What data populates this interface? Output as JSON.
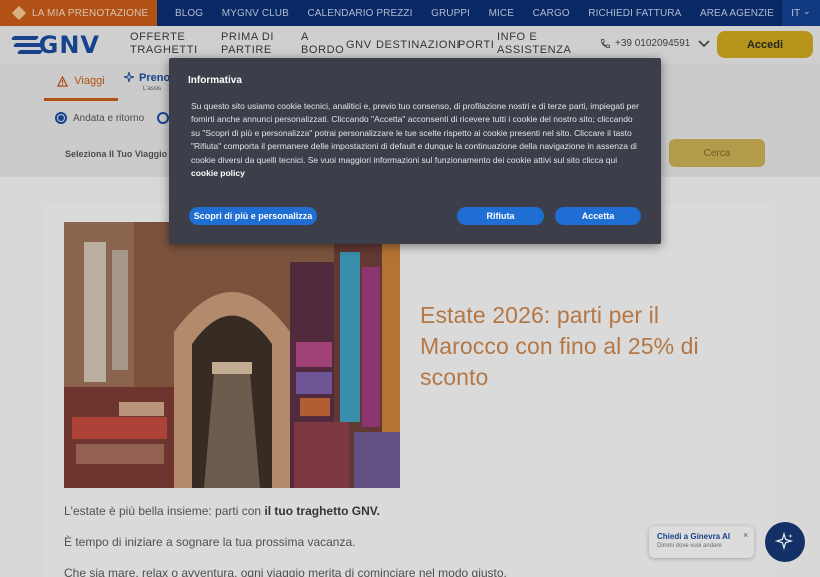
{
  "topbar": {
    "booking": "LA MIA PRENOTAZIONE",
    "links": [
      "BLOG",
      "MYGNV CLUB",
      "CALENDARIO PREZZI",
      "GRUPPI",
      "MICE",
      "CARGO",
      "RICHIEDI FATTURA",
      "AREA AGENZIE"
    ],
    "lang": "IT",
    "lang_chevron": "⌄"
  },
  "nav": {
    "logo": "GNV",
    "items": [
      {
        "line1": "OFFERTE",
        "line2": "TRAGHETTI"
      },
      {
        "line1": "PRIMA DI",
        "line2": "PARTIRE"
      },
      {
        "line1": "A",
        "line2": "BORDO"
      },
      {
        "line1": "GNV",
        "line2": ""
      },
      {
        "line1": "DESTINAZIONI",
        "line2": ""
      },
      {
        "line1": "PORTI",
        "line2": ""
      },
      {
        "line1": "INFO E",
        "line2": "ASSISTENZA"
      }
    ],
    "phone": "+39 0102094591",
    "login": "Accedi"
  },
  "search": {
    "tab_viaggi": "Viaggi",
    "tab_preno": "Preno",
    "tab_preno_sub": "L'assis",
    "radio_round": "Andata e ritorno",
    "route_label": "Seleziona Il Tuo Viaggio",
    "search_button": "Cerca"
  },
  "article": {
    "headline": "Estate 2026: parti per il Marocco con fino al 25% di sconto",
    "p1_prefix": "L'estate è più bella insieme: parti con ",
    "p1_bold": "il tuo traghetto GNV.",
    "p2": "È tempo di iniziare a sognare la tua prossima vacanza.",
    "p3": "Che sia mare, relax o avventura, ogni viaggio merita di cominciare nel modo giusto."
  },
  "chat": {
    "title": "Chiedi a Ginevra AI",
    "subtitle": "Dimmi dove vuoi andare",
    "close": "×"
  },
  "cookie": {
    "title": "Informativa",
    "text": "Su questo sito usiamo cookie tecnici, analitici e, previo tuo consenso, di profilazione nostri e di terze parti, impiegati per fornirti anche annunci personalizzati. Cliccando \"Accetta\" acconsenti di ricevere tutti i cookie del nostro sito; cliccando su \"Scopri di più e personalizza\" potrai personalizzare le tue scelte rispetto ai cookie presenti nel sito. Cliccare il tasto \"Rifiuta\" comporta il permanere delle impostazioni di default e dunque la continuazione della navigazione in assenza di cookie diversi da quelli tecnici. Se vuoi maggiori informazioni sul funzionamento dei cookie attivi sul sito clicca qui ",
    "policy_link": "cookie policy",
    "btn_customize": "Scopri di più e personalizza",
    "btn_reject": "Rifiuta",
    "btn_accept": "Accetta"
  },
  "colors": {
    "topbar": "#0a2d72",
    "booking": "#c75b18",
    "accent_yellow": "#caa51c",
    "brand_blue": "#1a4b9c",
    "modal_bg": "#3c3f4a",
    "modal_button": "#1f6ed4",
    "headline": "#c8864f"
  }
}
